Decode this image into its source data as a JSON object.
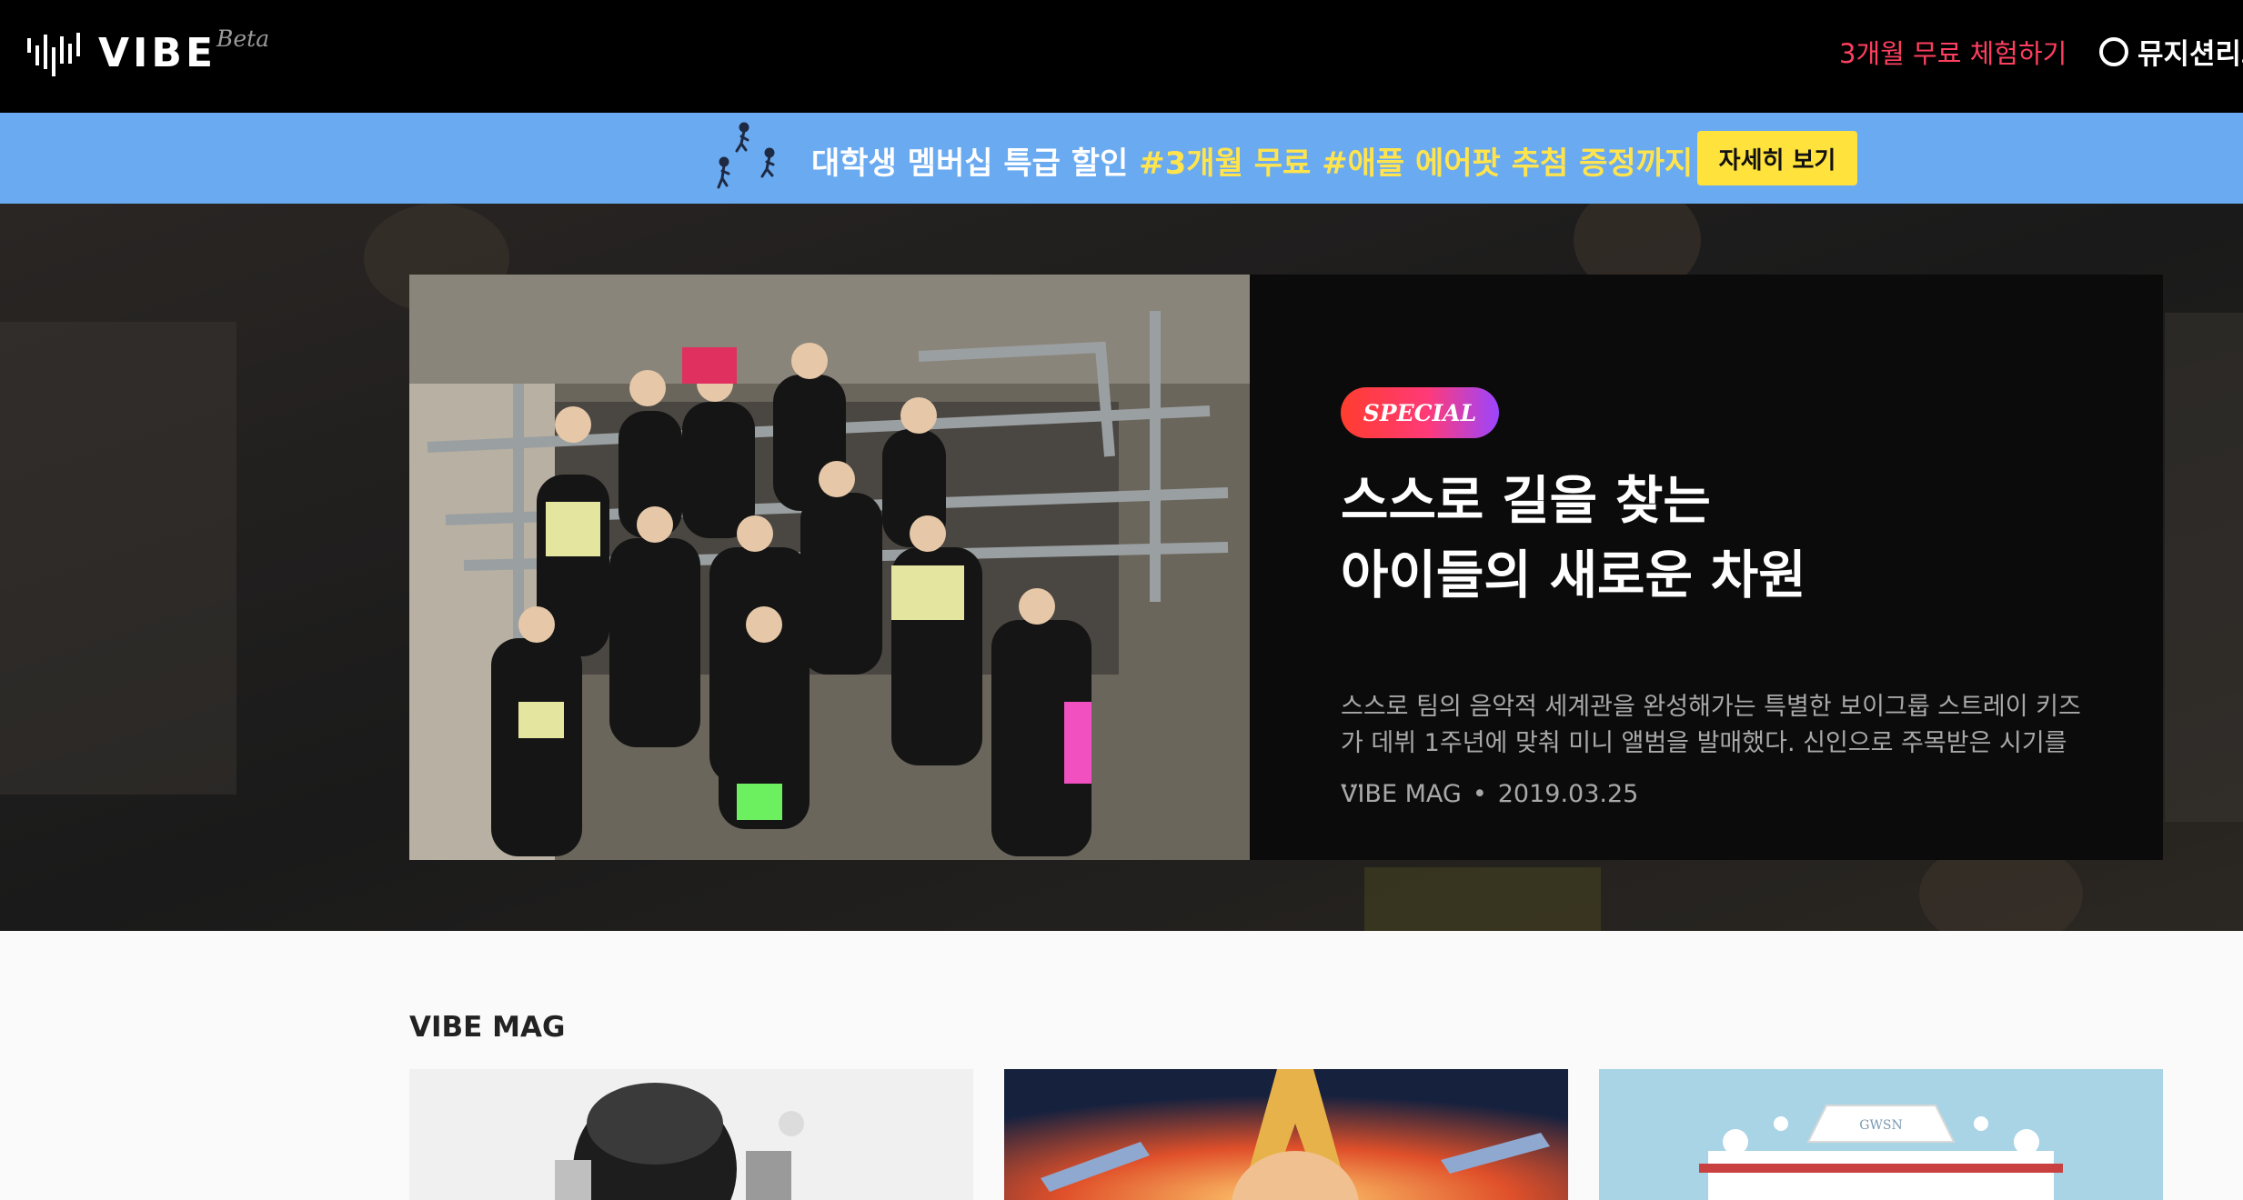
{
  "header": {
    "logo_text": "VIBE",
    "logo_beta": "Beta",
    "trial_link": "3개월 무료 체험하기",
    "library_link": "뮤지션리그"
  },
  "banner": {
    "text_main": "대학생 멤버십 특급 할인",
    "tag1": "#3개월 무료",
    "tag2": "#애플 에어팟 추첨 증정까지!",
    "button_label": "자세히 보기"
  },
  "feature": {
    "badge": "SPECIAL",
    "title_line1": "스스로 길을 찾는",
    "title_line2": "아이들의 새로운 차원",
    "desc_line1": "스스로 팀의 음악적 세계관을 완성해가는 특별한 보이그룹 스트레이 키즈",
    "desc_line2": "가 데뷔 1주년에 맞춰 미니 앨범을 발매했다. 신인으로 주목받은 시기를 ...",
    "source": "VIBE MAG",
    "date": "2019.03.25"
  },
  "mag": {
    "section_title": "VIBE MAG",
    "thumb3_sign": "GWSN"
  },
  "colors": {
    "accent_red": "#ff3f5f",
    "banner_blue": "#6aaaf0",
    "button_yellow": "#ffe23b",
    "tag_yellow": "#ffe44d"
  }
}
